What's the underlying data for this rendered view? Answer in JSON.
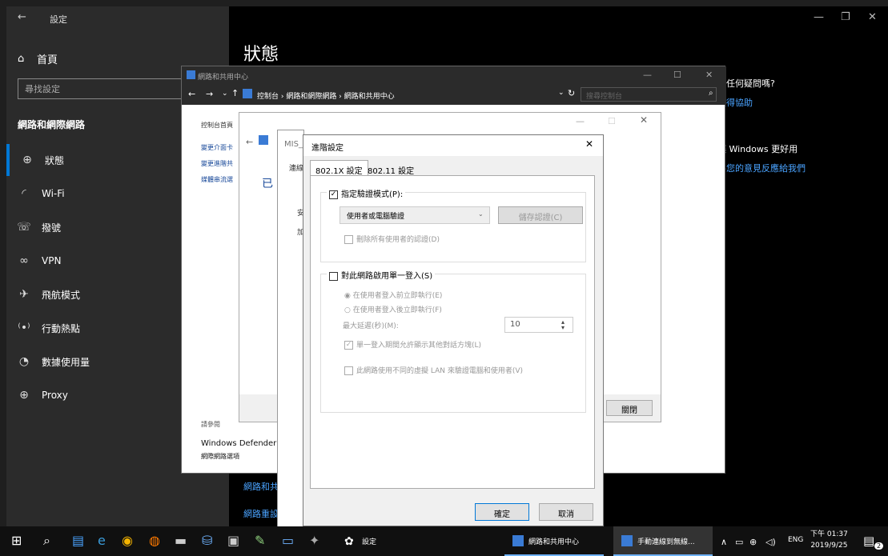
{
  "settings": {
    "title": "設定",
    "home": "首頁",
    "search_placeholder": "尋找設定",
    "section": "網路和網際網路",
    "page_title": "狀態",
    "nav": [
      {
        "icon": "globe-icon",
        "label": "狀態"
      },
      {
        "icon": "wifi-icon",
        "label": "Wi-Fi"
      },
      {
        "icon": "dialup-icon",
        "label": "撥號"
      },
      {
        "icon": "vpn-icon",
        "label": "VPN"
      },
      {
        "icon": "airplane-icon",
        "label": "飛航模式"
      },
      {
        "icon": "hotspot-icon",
        "label": "行動熱點"
      },
      {
        "icon": "data-usage-icon",
        "label": "數據使用量"
      },
      {
        "icon": "proxy-icon",
        "label": "Proxy"
      }
    ],
    "right_question": "有任何疑問嗎?",
    "right_help": "取得協助",
    "right_better": "讓 Windows 更好用",
    "right_feedback": "將您的意見反應給我們",
    "bottom_link1": "網路和共用中心",
    "bottom_link2": "網路重設",
    "glyphs": {
      "home": "⌂",
      "status": "⊕",
      "wifi": "◜",
      "dial": "☏",
      "vpn": "∞",
      "air": "✈",
      "hot": "⁽•⁾",
      "data": "◔",
      "proxy": "⊕"
    }
  },
  "ncpa": {
    "title": "網路和共用中心",
    "crumbs": "控制台 › 網路和網際網路 › 網路和共用中心",
    "search_placeholder": "搜尋控制台",
    "side_links": [
      "控制台首頁",
      "變更介面卡",
      "變更進階共",
      "媒體串流選"
    ],
    "see_also": "請參閱",
    "defender": "Windows Defender 防",
    "inet": "網際網路選項"
  },
  "wstatus": {
    "close_button": "關閉",
    "snippet": "已"
  },
  "misprop": {
    "title": "MIS_",
    "tab": "連線",
    "char1": "安",
    "char2": "加"
  },
  "adv": {
    "title": "進階設定",
    "tabs": [
      "802.1X 設定",
      "802.11 設定"
    ],
    "auth_mode_label": "指定驗證模式(P):",
    "auth_mode_value": "使用者或電腦驗證",
    "save_creds": "儲存認證(C)",
    "delete_creds": "刪除所有使用者的認證(D)",
    "sso_label": "對此網路啟用單一登入(S)",
    "before_logon": "在使用者登入前立即執行(E)",
    "after_logon": "在使用者登入後立即執行(F)",
    "max_delay_label": "最大延遲(秒)(M):",
    "max_delay_value": "10",
    "allow_dialogs": "單一登入期間允許顯示其他對話方塊(L)",
    "separate_vlan": "此網路使用不同的虛擬 LAN 來驗證電腦和使用者(V)",
    "ok": "確定",
    "cancel": "取消"
  },
  "taskbar": {
    "settings_label": "設定",
    "ncpa_label": "網路和共用中心",
    "manual_label": "手動連線到無線...",
    "lang": "ENG",
    "time": "下午 01:37",
    "date": "2019/9/25",
    "notif_count": "2"
  }
}
